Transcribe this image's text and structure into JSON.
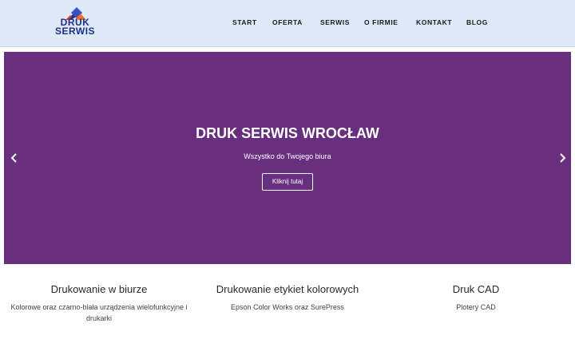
{
  "logo": {
    "line1": "DRUK",
    "line2": "SERWIS"
  },
  "nav": {
    "items": [
      {
        "label": "START"
      },
      {
        "label": "OFERTA"
      },
      {
        "label": "SERWIS"
      },
      {
        "label": "O FIRMIE"
      },
      {
        "label": "KONTAKT"
      },
      {
        "label": "BLOG"
      }
    ]
  },
  "hero": {
    "title": "DRUK SERWIS WROCŁAW",
    "subtitle": "Wszystko do Twojego biura",
    "button_label": "Kliknij tutaj",
    "background_color": "#672f7e",
    "prev_icon": "chevron-left-icon",
    "next_icon": "chevron-right-icon"
  },
  "features": [
    {
      "title": "Drukowanie w biurze",
      "text": "Kolorowe oraz czarno-biała urządzenia wielofunkcyjne i drukarki"
    },
    {
      "title": "Drukowanie etykiet kolorowych",
      "text": "Epson Color Works oraz SurePress"
    },
    {
      "title": "Druk CAD",
      "text": "Plotery CAD"
    }
  ],
  "colors": {
    "header_bg": "#dde9f6",
    "logo_blue": "#1d2f86",
    "logo_orange": "#e8732a"
  }
}
